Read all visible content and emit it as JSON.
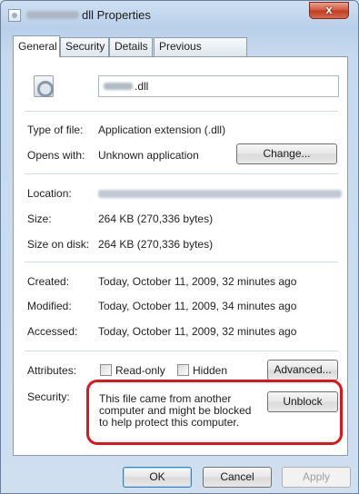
{
  "window": {
    "title_suffix": "dll Properties",
    "close_label": "x"
  },
  "tabs": [
    "General",
    "Security",
    "Details",
    "Previous Versions"
  ],
  "general": {
    "file_ext": ".dll",
    "type_label": "Type of file:",
    "type_value": "Application extension (.dll)",
    "opens_label": "Opens with:",
    "opens_value": "Unknown application",
    "change_button": "Change...",
    "location_label": "Location:",
    "size_label": "Size:",
    "size_value": "264 KB (270,336 bytes)",
    "size_on_disk_label": "Size on disk:",
    "size_on_disk_value": "264 KB (270,336 bytes)",
    "created_label": "Created:",
    "created_value": "Today, October 11, 2009, 32 minutes ago",
    "modified_label": "Modified:",
    "modified_value": "Today, October 11, 2009, 34 minutes ago",
    "accessed_label": "Accessed:",
    "accessed_value": "Today, October 11, 2009, 32 minutes ago",
    "attributes_label": "Attributes:",
    "readonly_label": "Read-only",
    "hidden_label": "Hidden",
    "advanced_button": "Advanced...",
    "security_label": "Security:",
    "security_text": "This file came from another computer and might be blocked to help protect this computer.",
    "unblock_button": "Unblock"
  },
  "footer": {
    "ok": "OK",
    "cancel": "Cancel",
    "apply": "Apply"
  },
  "colors": {
    "highlight_border": "#e0141b",
    "ok_button_border": "#3c7fb1"
  }
}
